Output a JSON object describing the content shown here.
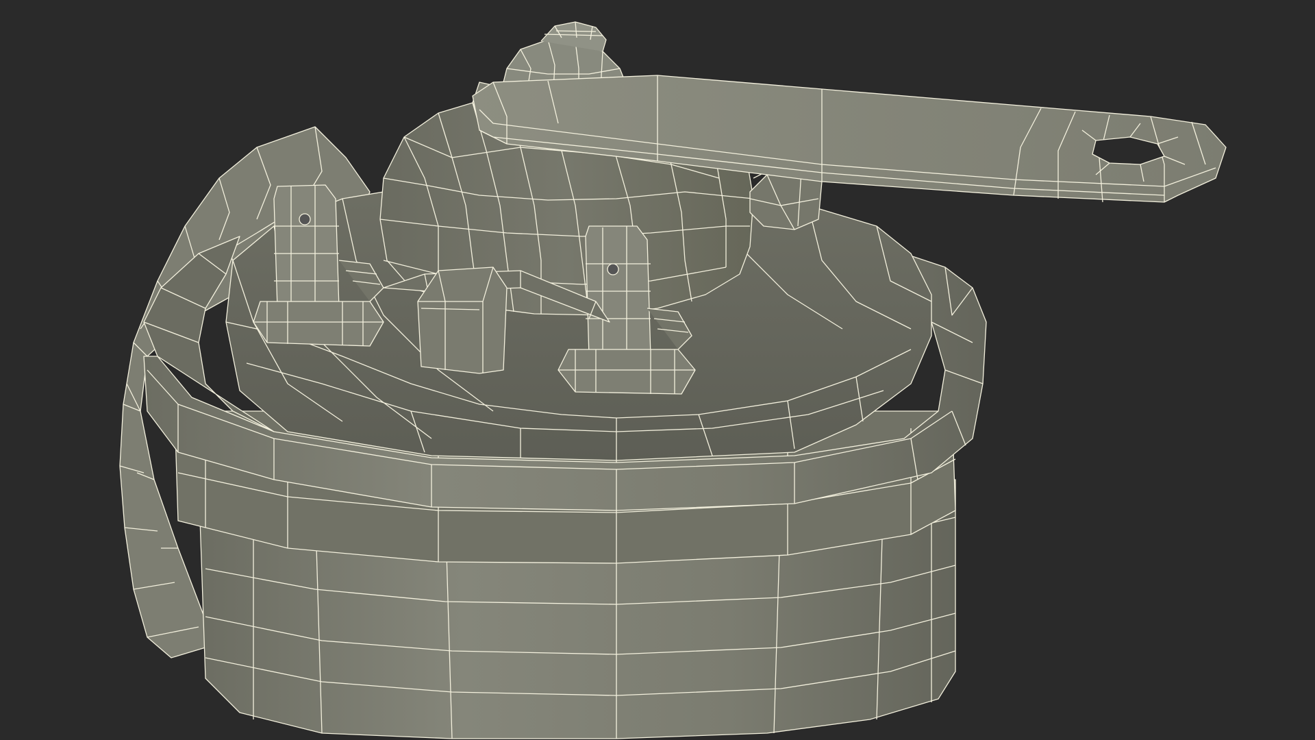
{
  "scene": {
    "subject": "horn-wireframe-render",
    "colors": {
      "background": "#2a2a2a",
      "surface_light": "#8a8b7e",
      "surface_mid": "#7a7b6f",
      "surface_dark": "#5f6057",
      "surface_shadow": "#4a4b44",
      "wire": "#f4f1de"
    }
  }
}
